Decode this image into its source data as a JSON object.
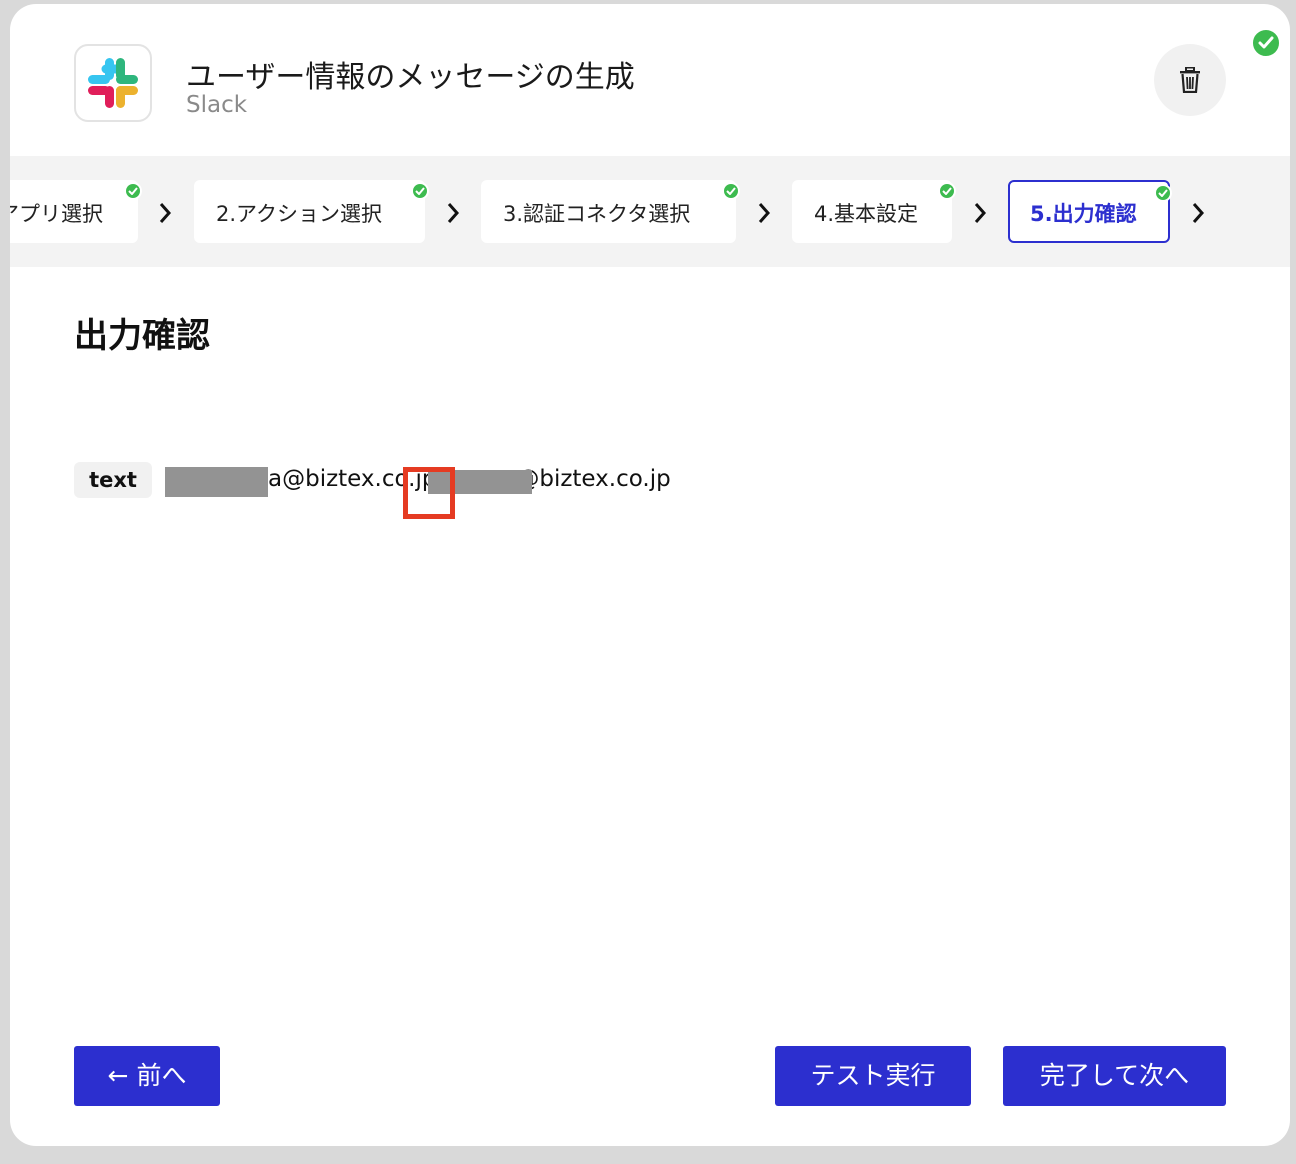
{
  "header": {
    "title": "ユーザー情報のメッセージの生成",
    "app_name": "Slack",
    "icons": {
      "app": "slack-logo-icon",
      "delete": "trash-icon",
      "status": "check-circle-icon"
    }
  },
  "steps": [
    {
      "label": "アプリ選択",
      "completed": true,
      "active": false
    },
    {
      "label": "2.アクション選択",
      "completed": true,
      "active": false
    },
    {
      "label": "3.認証コネクタ選択",
      "completed": true,
      "active": false
    },
    {
      "label": "4.基本設定",
      "completed": true,
      "active": false
    },
    {
      "label": "5.出力確認",
      "completed": true,
      "active": true
    }
  ],
  "section": {
    "title": "出力確認"
  },
  "output": {
    "key": "text",
    "value": "a@biztex.co.jp,        a@biztex.co.jp"
  },
  "buttons": {
    "prev": "← 前へ",
    "test": "テスト実行",
    "complete_next": "完了して次へ"
  },
  "colors": {
    "accent": "#2c2fcf",
    "success": "#3dbb4f",
    "highlight": "#e53b22"
  }
}
